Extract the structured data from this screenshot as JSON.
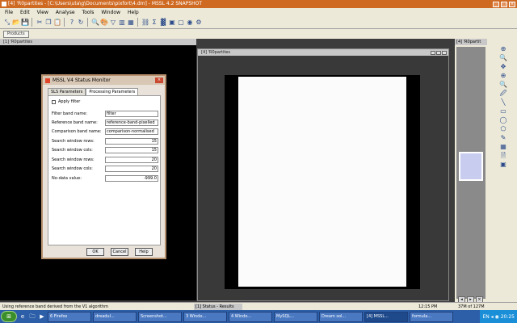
{
  "window": {
    "title": "[4] 'R0partites - [C:\\Users\\uta\\g\\Documents\\pixfort\\4.dm] - MSSL 4.2 SNAPSHOT",
    "controls": [
      "_",
      "□",
      "×"
    ]
  },
  "menu": {
    "items": [
      "File",
      "Edit",
      "View",
      "Analyse",
      "Tools",
      "Window",
      "Help"
    ]
  },
  "toolbar": {
    "icons": [
      "select-icon",
      "open-icon",
      "save-icon",
      "cut-icon",
      "copy-icon",
      "paste-icon",
      "help-icon",
      "rotate-icon",
      "magnify-icon",
      "palette-icon",
      "filter-icon",
      "chart-icon",
      "grid-icon",
      "link-icon",
      "sum-icon",
      "lut-icon",
      "image-icon",
      "frame-icon",
      "globe-icon",
      "gear-icon"
    ],
    "glyphs": [
      "⤡",
      "📂",
      "💾",
      "✂",
      "❐",
      "📋",
      "?",
      "↻",
      "🔍",
      "🎨",
      "▽",
      "▥",
      "▦",
      "⛓",
      "Σ",
      "▓",
      "▣",
      "▢",
      "◉",
      "⚙"
    ]
  },
  "toolbar2": {
    "button_label": "Products"
  },
  "subwin1": {
    "title": "[1] 'R0partites"
  },
  "subwin2": {
    "title": "[4] 'R0partites"
  },
  "rightpanel": {
    "title": "[4] 'R0partit",
    "tools": [
      "⊕",
      "🔍",
      "✥",
      "⊕",
      "🔍",
      "🖉",
      "╲",
      "▭",
      "◯",
      "⬠",
      "✎",
      "▦",
      "🗎",
      "▣"
    ],
    "bottom": [
      "◂",
      "▸",
      "×"
    ]
  },
  "dialog": {
    "title": "MSSL V4 Status Monitor",
    "tabs": [
      "SLS Parameters",
      "Processing Parameters"
    ],
    "filter_label": "Apply filter",
    "fields": [
      {
        "label": "Filter band name:",
        "value": "filter"
      },
      {
        "label": "Reference band name:",
        "value": "reference-band-pixelled"
      },
      {
        "label": "Comparison band name:",
        "value": "comparison-normalised"
      },
      {
        "label": "Search window rows:",
        "value": "15"
      },
      {
        "label": "Search window cols:",
        "value": "15"
      },
      {
        "label": "Search window rows:",
        "value": "20"
      },
      {
        "label": "Search window cols:",
        "value": "20"
      },
      {
        "label": "No-data value:",
        "value": "-999.0"
      }
    ],
    "buttons": {
      "ok": "OK",
      "cancel": "Cancel",
      "help": "Help"
    }
  },
  "status": {
    "message": "Using reference band derived from the V1 algorithm",
    "tab": "[1] Status - Results",
    "time": "12:15 PM",
    "memory": "37M of 127M",
    "clock": "20:25"
  },
  "taskbar": {
    "start": "⊞",
    "quicklaunch": [
      "e",
      "🗀",
      "▶"
    ],
    "tasks": [
      "6 Firefox",
      "dreadul...",
      "Screenshot...",
      "3 Windo...",
      "4 Windo...",
      "MySQL...",
      "Dream sol...",
      "[4] MSSL...",
      "formula..."
    ],
    "tray": "EN  ◂ ◉ 20:25"
  }
}
